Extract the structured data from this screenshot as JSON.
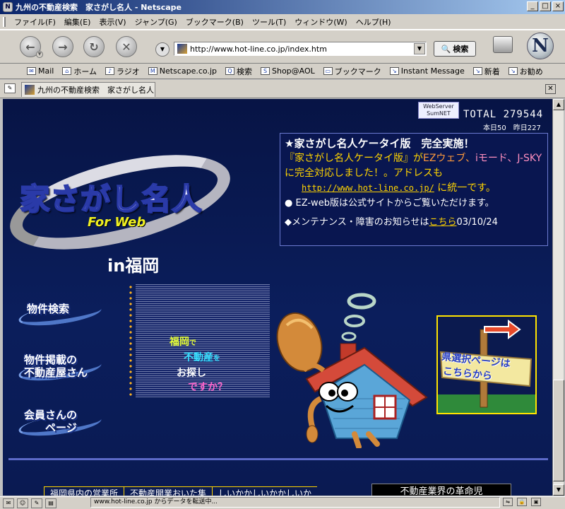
{
  "window": {
    "title": "九州の不動産検索　家さがし名人 - Netscape",
    "controls": [
      "_",
      "□",
      "×"
    ]
  },
  "menu": [
    "ファイル(F)",
    "編集(E)",
    "表示(V)",
    "ジャンプ(G)",
    "ブックマーク(B)",
    "ツール(T)",
    "ウィンドウ(W)",
    "ヘルプ(H)"
  ],
  "nav": {
    "url": "http://www.hot-line.co.jp/index.htm",
    "search_label": "検索",
    "buttons": {
      "back": "←",
      "forward": "→",
      "reload": "↻",
      "stop": "✕"
    }
  },
  "personal_toolbar": [
    "Mail",
    "ホーム",
    "ラジオ",
    "Netscape.co.jp",
    "検索",
    "Shop@AOL",
    "ブックマーク",
    "Instant Message",
    "新着",
    "お勧め"
  ],
  "tab": {
    "label": "九州の不動産検索　家さがし名人"
  },
  "page": {
    "webserver": "WebServer SumNET",
    "total": "TOTAL  279544",
    "counts": "本日50　昨日227",
    "logo_main": "家さがし名人",
    "logo_sub": "For Web",
    "location": "in福岡",
    "news": {
      "line1": "★家さがし名人ケータイ版　完全実施！",
      "line2a": "『家さがし名人ケータイ版』が",
      "line2b": "EZウェブ、",
      "line2c": "iモード、J-SKY",
      "line3": "に完全対応しました！。アドレスも",
      "url": "http://www.hot-line.co.jp/",
      "line4": "に統一です。",
      "line5a": "● EZ-web版",
      "line5b": "は公式サイトからご覧いただけます。",
      "line6a": "◆メンテナンス・障害のお知らせは",
      "line6link": "こちら",
      "line6date": "03/10/24"
    },
    "side_buttons": {
      "search": "物件検索",
      "agents_line1": "物件掲載の",
      "agents_line2": "不動産屋さん",
      "members_line1": "会員さんの",
      "members_line2": "ページ"
    },
    "tagline": {
      "w1": "福岡",
      "w1s": "で",
      "w2": "不動産",
      "w2s": "を",
      "w3": "お探し",
      "w4": "ですか？"
    },
    "pref_sign": {
      "line1": "県選択ページは",
      "line2": "こちらから"
    },
    "bottom_links": [
      "福岡県内の営業所",
      "不動産開業おいた集",
      "しいかかしいかかしいか"
    ],
    "industry": "不動産業界の革命児"
  },
  "status": {
    "text": "www.hot-line.co.jp からデータを転送中..."
  },
  "colors": {
    "page_bg": "#0b1a4f",
    "accent_yellow": "#ffd400",
    "titlebar": "#0a246a"
  }
}
